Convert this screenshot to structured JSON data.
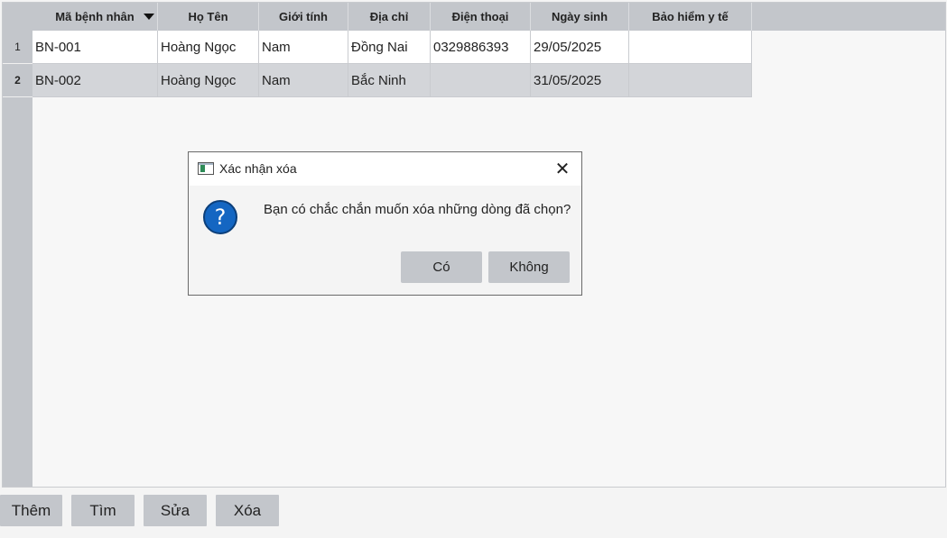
{
  "table": {
    "columns": [
      "Mã bệnh nhân",
      "Họ Tên",
      "Giới tính",
      "Địa chỉ",
      "Điện thoại",
      "Ngày sinh",
      "Bảo hiểm y tế"
    ],
    "sort_column": "Mã bệnh nhân",
    "selected_row": 2,
    "rows": [
      {
        "num": "1",
        "cells": [
          "BN-001",
          "Hoàng Ngọc",
          "Nam",
          "Đồng Nai",
          "0329886393",
          "29/05/2025",
          ""
        ]
      },
      {
        "num": "2",
        "cells": [
          "BN-002",
          "Hoàng Ngọc",
          "Nam",
          "Bắc Ninh",
          "",
          "31/05/2025",
          ""
        ]
      }
    ]
  },
  "buttons": {
    "add": "Thêm",
    "find": "Tìm",
    "edit": "Sửa",
    "delete": "Xóa"
  },
  "dialog": {
    "title": "Xác nhận xóa",
    "icon": "question-icon",
    "icon_glyph": "?",
    "message": "Bạn có chắc chắn muốn xóa những dòng đã chọn?",
    "yes": "Có",
    "no": "Không",
    "close_glyph": "✕"
  },
  "colors": {
    "header_bg": "#c3c6cb",
    "selected_row_bg": "#d3d5d9",
    "question_icon": "#1466c2"
  }
}
